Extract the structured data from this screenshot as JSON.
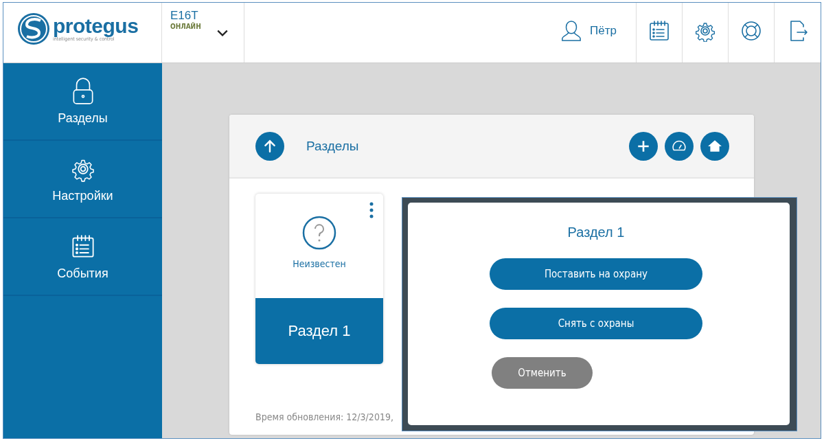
{
  "logo": {
    "name": "protegus",
    "tagline": "intelligent security & control"
  },
  "device": {
    "name": "E16T",
    "status": "ОНЛАЙН",
    "expanded": false
  },
  "user": {
    "name": "Пётр"
  },
  "toolbar": [
    {
      "kind": "events"
    },
    {
      "kind": "settings"
    },
    {
      "kind": "help"
    },
    {
      "kind": "logout"
    }
  ],
  "sidebar": {
    "items": [
      {
        "kind": "lock",
        "label": "Разделы"
      },
      {
        "kind": "gear",
        "label": "Настройки"
      },
      {
        "kind": "events",
        "label": "События"
      }
    ]
  },
  "panel": {
    "title": "Разделы",
    "actions": [
      {
        "kind": "add"
      },
      {
        "kind": "gauge"
      },
      {
        "kind": "home"
      }
    ],
    "cards": [
      {
        "status": "Неизвестен",
        "name": "Раздел 1"
      }
    ],
    "updated": "Время обновления: 12/3/2019,"
  },
  "dialog": {
    "title": "Раздел 1",
    "buttons": [
      {
        "label": "Поставить на охрану",
        "kind": "primary"
      },
      {
        "label": "Снять с охраны",
        "kind": "primary"
      },
      {
        "label": "Отменить",
        "kind": "secondary"
      }
    ]
  }
}
